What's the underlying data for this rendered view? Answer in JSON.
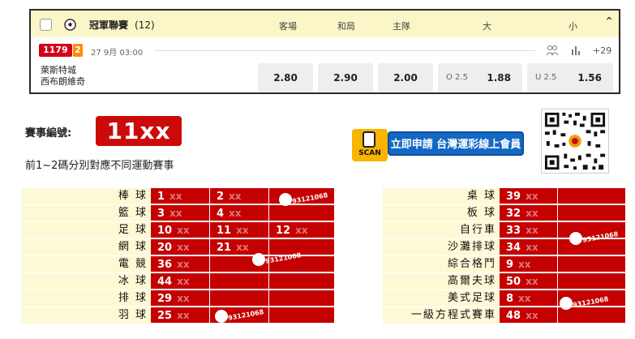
{
  "match": {
    "league_name": "冠軍聯賽",
    "league_count": "(12)",
    "col_away": "客場",
    "col_draw": "和局",
    "col_home": "主隊",
    "col_over": "大",
    "col_under": "小",
    "match_id": "1179",
    "match_no": "2",
    "datetime": "27 9月   03:00",
    "more": "+29",
    "team_1": "萊斯特城",
    "team_2": "西布朗維奇",
    "odd_away": "2.80",
    "odd_draw": "2.90",
    "odd_home": "2.00",
    "over_line": "O 2.5",
    "over_odd": "1.88",
    "under_line": "U 2.5",
    "under_odd": "1.56"
  },
  "code": {
    "label": "賽事編號:",
    "value": "11xx",
    "note": "前1~2碼分別對應不同運動賽事"
  },
  "promo": {
    "scan_label": "SCAN",
    "banner_text": "立即申請 台灣運彩線上會員"
  },
  "watermark": "93121068",
  "left_table": [
    {
      "sport": "棒 球",
      "c1": "1",
      "c2": "2",
      "c3": ""
    },
    {
      "sport": "籃 球",
      "c1": "3",
      "c2": "4",
      "c3": ""
    },
    {
      "sport": "足 球",
      "c1": "10",
      "c2": "11",
      "c3": "12"
    },
    {
      "sport": "網 球",
      "c1": "20",
      "c2": "21",
      "c3": ""
    },
    {
      "sport": "電 競",
      "c1": "36",
      "c2": "",
      "c3": ""
    },
    {
      "sport": "冰 球",
      "c1": "44",
      "c2": "",
      "c3": ""
    },
    {
      "sport": "排 球",
      "c1": "29",
      "c2": "",
      "c3": ""
    },
    {
      "sport": "羽 球",
      "c1": "25",
      "c2": "",
      "c3": ""
    }
  ],
  "right_table": [
    {
      "sport": "桌 球",
      "c1": "39"
    },
    {
      "sport": "板 球",
      "c1": "32"
    },
    {
      "sport": "自行車",
      "c1": "33"
    },
    {
      "sport": "沙灘排球",
      "c1": "34"
    },
    {
      "sport": "綜合格鬥",
      "c1": "9"
    },
    {
      "sport": "高爾夫球",
      "c1": "50"
    },
    {
      "sport": "美式足球",
      "c1": "8"
    },
    {
      "sport": "一級方程式賽車",
      "c1": "48"
    }
  ],
  "xx": "xx",
  "colors": {
    "accent_red": "#cc0a0a",
    "header_yellow": "#fbf6c7",
    "banner_blue": "#1368c4"
  }
}
